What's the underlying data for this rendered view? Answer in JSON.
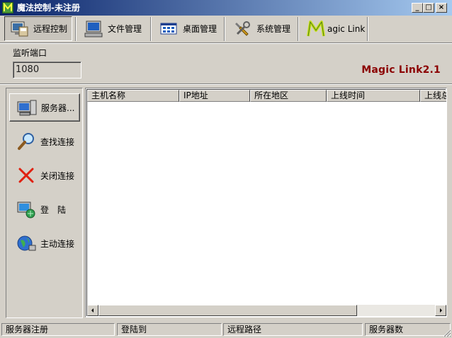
{
  "window": {
    "title": "魔法控制-未注册",
    "min_glyph": "_",
    "max_glyph": "□",
    "close_glyph": "×"
  },
  "toolbar": {
    "items": [
      {
        "label": "远程控制",
        "icon": "remote-control-icon"
      },
      {
        "label": "文件管理",
        "icon": "computer-icon"
      },
      {
        "label": "桌面管理",
        "icon": "desktop-window-icon"
      },
      {
        "label": "系统管理",
        "icon": "tools-icon"
      },
      {
        "label": "agic Link",
        "icon": "magic-m-logo-icon"
      }
    ]
  },
  "port": {
    "label": "监听端口",
    "value": "1080"
  },
  "brand": "Magic Link2.1",
  "left_buttons": [
    {
      "label": "服务器...",
      "icon": "server-computer-icon"
    },
    {
      "label": "查找连接",
      "icon": "magnifier-icon"
    },
    {
      "label": "关闭连接",
      "icon": "red-x-icon"
    },
    {
      "label": "登　陆",
      "icon": "network-computer-icon"
    },
    {
      "label": "主动连接",
      "icon": "globe-icon"
    }
  ],
  "table": {
    "columns": [
      "主机名称",
      "IP地址",
      "所在地区",
      "上线时间",
      "上线总"
    ],
    "rows": []
  },
  "statusbar": [
    "服务器注册",
    "登陆到",
    "远程路径",
    "服务器数"
  ],
  "colors": {
    "titlebar_start": "#0a246a",
    "titlebar_end": "#a6caf0",
    "brand": "#8b0000",
    "face": "#d4d0c8"
  }
}
